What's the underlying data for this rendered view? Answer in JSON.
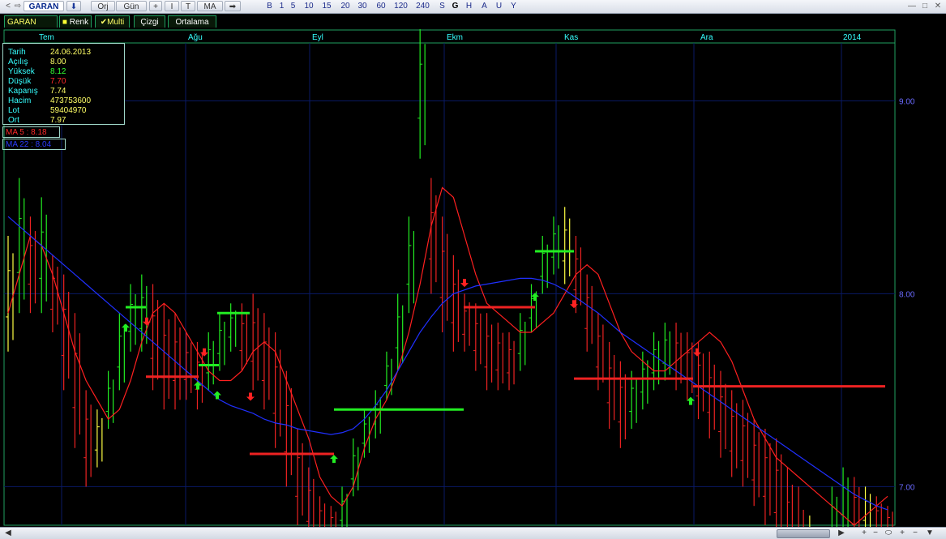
{
  "toolbar": {
    "nav_back": "<",
    "nav_fwd": "⇨",
    "symbol": "GARAN",
    "arrow": "⬇",
    "orj": "Orj",
    "period": "Gün",
    "plus": "+",
    "line_tool": "I",
    "text_tool": "T",
    "ma": "MA",
    "next": "➡",
    "timeframes": [
      "B",
      "1",
      "5",
      "10",
      "15",
      "20",
      "30",
      "60",
      "120",
      "240",
      "S",
      "G",
      "H",
      "A",
      "U",
      "Y"
    ],
    "selected_timeframe": "G",
    "win_min": "—",
    "win_max": "□",
    "win_close": "✕"
  },
  "tabs": {
    "symbol": "GARAN",
    "renk": "Renk",
    "multi": "Multi",
    "cizgi": "Çizgi",
    "ortalama": "Ortalama"
  },
  "info": {
    "labels": [
      "Tarih",
      "Açılış",
      "Yüksek",
      "Düşük",
      "Kapanış",
      "Hacim",
      "Lot",
      "Ort"
    ],
    "values": [
      "24.06.2013",
      "8.00",
      "8.12",
      "7.70",
      "7.74",
      "473753600",
      "59404970",
      "7.97"
    ],
    "value_colors": [
      "#ffff66",
      "#ffff66",
      "#33ff33",
      "#ff2a2a",
      "#ffff66",
      "#ffff66",
      "#ffff66",
      "#ffff66"
    ]
  },
  "ma": {
    "ma5_label": "MA 5 : 8.18",
    "ma22_label": "MA 22 : 8.04"
  },
  "colors": {
    "up": "#22ee22",
    "down": "#ee2222",
    "doji": "#ffff44",
    "ma5": "#ff2020",
    "ma22": "#2030ff",
    "grid": "#0a1a66",
    "axis_text": "#6a6aff",
    "month_text": "#36ffff",
    "frame": "#1fa060"
  },
  "bottombar": {
    "left_arrow": "◀",
    "right_arrow": "▶",
    "zoom_in": "+",
    "zoom_out": "−",
    "fit": "⬭",
    "plus2": "+",
    "minus2": "−",
    "menu": "▼"
  },
  "chart_data": {
    "type": "ohlc",
    "symbol": "GARAN",
    "x_month_labels": [
      "Tem",
      "Ağu",
      "Eyl",
      "Ekm",
      "Kas",
      "Ara",
      "2014"
    ],
    "y_tick_labels": [
      "7.00",
      "8.00",
      "9.00"
    ],
    "ylim": [
      6.8,
      9.3
    ],
    "grid": true,
    "series": [
      {
        "name": "MA 5",
        "values": [
          7.9,
          8.1,
          8.3,
          8.25,
          8.1,
          7.9,
          7.7,
          7.55,
          7.45,
          7.35,
          7.4,
          7.55,
          7.75,
          7.9,
          7.95,
          7.9,
          7.8,
          7.7,
          7.6,
          7.55,
          7.55,
          7.6,
          7.7,
          7.75,
          7.7,
          7.55,
          7.4,
          7.25,
          7.05,
          6.95,
          6.9,
          7.0,
          7.2,
          7.35,
          7.45,
          7.6,
          7.8,
          8.05,
          8.35,
          8.55,
          8.5,
          8.3,
          8.1,
          7.95,
          7.9,
          7.85,
          7.8,
          7.8,
          7.85,
          7.9,
          8.0,
          8.1,
          8.15,
          8.1,
          7.95,
          7.8,
          7.7,
          7.65,
          7.6,
          7.6,
          7.65,
          7.7,
          7.75,
          7.8,
          7.75,
          7.65,
          7.5,
          7.35,
          7.25,
          7.15,
          7.1,
          7.05,
          7.0,
          6.95,
          6.9,
          6.85,
          6.8,
          6.85,
          6.9,
          6.95
        ]
      },
      {
        "name": "MA 22",
        "values": [
          8.4,
          8.35,
          8.3,
          8.25,
          8.2,
          8.15,
          8.1,
          8.05,
          8.0,
          7.95,
          7.9,
          7.85,
          7.8,
          7.75,
          7.7,
          7.65,
          7.6,
          7.55,
          7.5,
          7.45,
          7.42,
          7.4,
          7.38,
          7.35,
          7.33,
          7.32,
          7.3,
          7.29,
          7.28,
          7.27,
          7.28,
          7.3,
          7.35,
          7.42,
          7.5,
          7.6,
          7.7,
          7.8,
          7.88,
          7.95,
          8.0,
          8.02,
          8.04,
          8.05,
          8.06,
          8.07,
          8.08,
          8.08,
          8.07,
          8.05,
          8.02,
          7.98,
          7.94,
          7.9,
          7.85,
          7.8,
          7.76,
          7.72,
          7.68,
          7.64,
          7.6,
          7.56,
          7.52,
          7.48,
          7.44,
          7.4,
          7.36,
          7.32,
          7.28,
          7.24,
          7.2,
          7.16,
          7.12,
          7.08,
          7.04,
          7.0,
          6.96,
          6.93,
          6.9,
          6.88
        ]
      }
    ],
    "ohlc_highs": [
      8.3,
      8.6,
      8.4,
      8.5,
      8.2,
      8.1,
      7.9,
      7.5,
      7.4,
      7.6,
      7.9,
      8.05,
      8.1,
      8.05,
      7.95,
      7.9,
      7.8,
      7.75,
      7.8,
      7.9,
      7.95,
      7.95,
      8.0,
      7.9,
      7.8,
      7.6,
      7.3,
      7.1,
      6.95,
      6.9,
      7.0,
      7.25,
      7.4,
      7.5,
      7.7,
      8.0,
      8.4,
      9.4,
      8.6,
      8.4,
      8.2,
      8.0,
      7.95,
      7.9,
      7.85,
      7.8,
      7.9,
      8.05,
      8.3,
      8.4,
      8.45,
      8.3,
      8.1,
      7.9,
      7.75,
      7.65,
      7.6,
      7.7,
      7.8,
      7.85,
      7.85,
      7.8,
      7.75,
      7.7,
      7.6,
      7.5,
      7.45,
      7.35,
      7.3,
      7.25,
      7.1,
      7.0,
      6.85,
      6.6,
      7.0,
      7.1,
      7.05,
      7.0,
      6.95,
      6.9
    ],
    "ohlc_lows": [
      7.7,
      7.9,
      7.9,
      7.9,
      7.8,
      7.5,
      7.2,
      7.0,
      7.1,
      7.3,
      7.5,
      7.7,
      7.7,
      7.5,
      7.4,
      7.4,
      7.45,
      7.4,
      7.5,
      7.6,
      7.7,
      7.6,
      7.5,
      7.4,
      7.2,
      7.0,
      6.8,
      6.7,
      6.7,
      6.7,
      6.75,
      6.95,
      7.15,
      7.25,
      7.45,
      7.6,
      7.9,
      8.7,
      8.0,
      7.8,
      7.7,
      7.7,
      7.6,
      7.5,
      7.5,
      7.5,
      7.6,
      7.8,
      8.0,
      8.1,
      8.05,
      7.9,
      7.7,
      7.5,
      7.3,
      7.2,
      7.3,
      7.4,
      7.5,
      7.55,
      7.5,
      7.45,
      7.35,
      7.25,
      7.15,
      7.05,
      7.0,
      6.9,
      6.8,
      6.7,
      6.5,
      6.2,
      6.35,
      6.45,
      6.65,
      6.75,
      6.7,
      6.75,
      6.7,
      6.7
    ],
    "annotations": [
      "buy-arrows",
      "sell-arrows",
      "support-lines",
      "resistance-lines"
    ]
  }
}
